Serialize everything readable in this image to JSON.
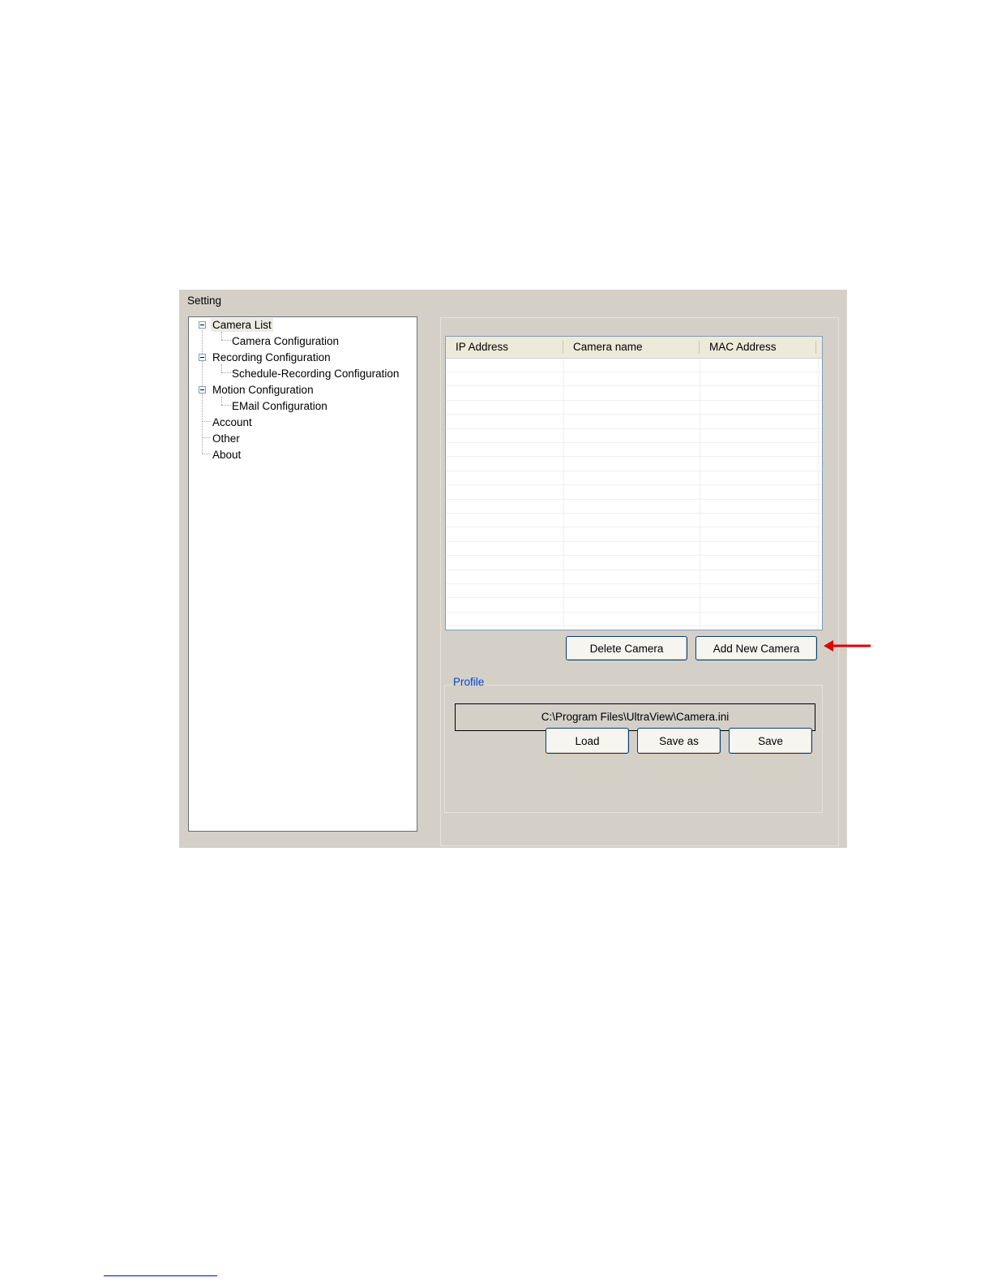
{
  "window": {
    "title": "Setting"
  },
  "tree": {
    "items": [
      {
        "label": "Camera List",
        "level": 0,
        "expandable": true,
        "selected": true
      },
      {
        "label": "Camera Configuration",
        "level": 1
      },
      {
        "label": "Recording Configuration",
        "level": 0,
        "expandable": true
      },
      {
        "label": "Schedule-Recording Configuration",
        "level": 1
      },
      {
        "label": "Motion Configuration",
        "level": 0,
        "expandable": true
      },
      {
        "label": "EMail Configuration",
        "level": 1
      },
      {
        "label": "Account",
        "level": 0
      },
      {
        "label": "Other",
        "level": 0
      },
      {
        "label": "About",
        "level": 0
      }
    ]
  },
  "camera_list": {
    "columns": [
      "IP Address",
      "Camera name",
      "MAC Address"
    ],
    "rows": []
  },
  "buttons": {
    "delete_camera": "Delete Camera",
    "add_new_camera": "Add New Camera"
  },
  "profile": {
    "label": "Profile",
    "path": "C:\\Program Files\\UltraView\\Camera.ini",
    "load": "Load",
    "save_as": "Save as",
    "save": "Save"
  },
  "colors": {
    "window_bg": "#d4d0c8",
    "profile_label": "#0046d5",
    "callout_arrow": "#e00000"
  }
}
